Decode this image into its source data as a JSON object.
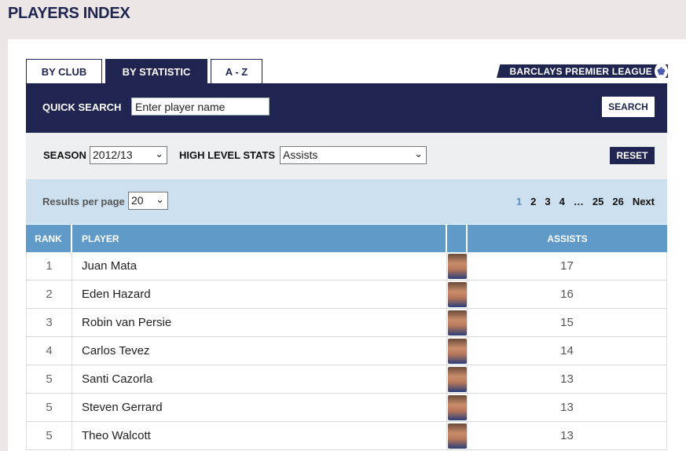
{
  "page": {
    "title": "PLAYERS INDEX"
  },
  "tabs": [
    {
      "label": "BY CLUB"
    },
    {
      "label": "BY STATISTIC"
    },
    {
      "label": "A - Z"
    }
  ],
  "logo": {
    "text": "BARCLAYS PREMIER LEAGUE"
  },
  "quick_search": {
    "label": "QUICK SEARCH",
    "value": "Enter player name",
    "button": "SEARCH"
  },
  "filters": {
    "season_label": "SEASON",
    "season_value": "2012/13",
    "stats_label": "HIGH LEVEL STATS",
    "stats_value": "Assists",
    "reset": "RESET"
  },
  "results": {
    "per_page_label": "Results per page",
    "per_page_value": "20",
    "pages": [
      "1",
      "2",
      "3",
      "4",
      "…",
      "25",
      "26",
      "Next"
    ],
    "current_page": "1"
  },
  "table": {
    "headers": {
      "rank": "RANK",
      "player": "PLAYER",
      "assists": "ASSISTS"
    },
    "rows": [
      {
        "rank": "1",
        "player": "Juan Mata",
        "assists": "17"
      },
      {
        "rank": "2",
        "player": "Eden Hazard",
        "assists": "16"
      },
      {
        "rank": "3",
        "player": "Robin van Persie",
        "assists": "15"
      },
      {
        "rank": "4",
        "player": "Carlos Tevez",
        "assists": "14"
      },
      {
        "rank": "5",
        "player": "Santi Cazorla",
        "assists": "13"
      },
      {
        "rank": "5",
        "player": "Steven Gerrard",
        "assists": "13"
      },
      {
        "rank": "5",
        "player": "Theo Walcott",
        "assists": "13"
      }
    ]
  }
}
